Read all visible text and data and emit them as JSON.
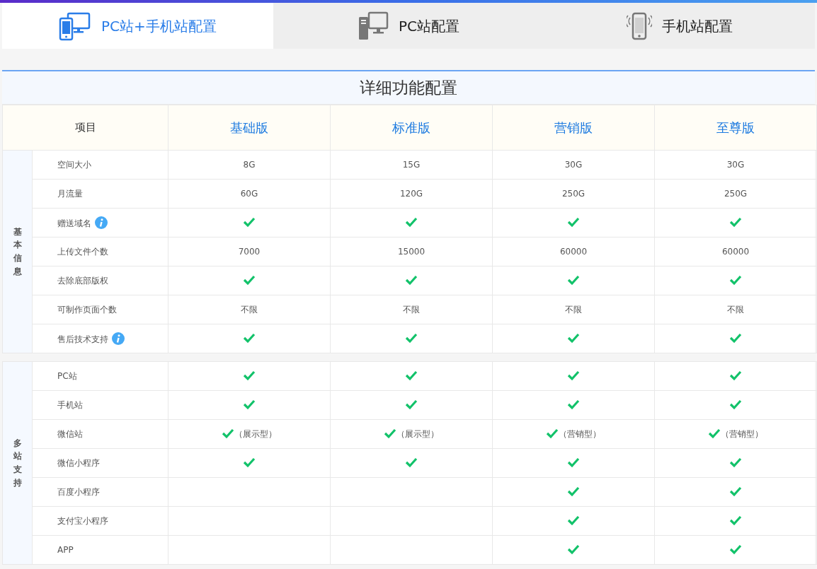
{
  "tabs": [
    {
      "label": "PC站+手机站配置",
      "kind": "combo",
      "selected": true
    },
    {
      "label": "PC站配置",
      "kind": "pc",
      "selected": false
    },
    {
      "label": "手机站配置",
      "kind": "mobile",
      "selected": false
    }
  ],
  "title": "详细功能配置",
  "header": {
    "item_label": "项目",
    "plans": [
      "基础版",
      "标准版",
      "营销版",
      "至尊版"
    ]
  },
  "sections": [
    {
      "label": "基本信息",
      "rows": [
        {
          "name": "空间大小",
          "info": false,
          "cells": [
            {
              "kind": "text",
              "text": "8G"
            },
            {
              "kind": "text",
              "text": "15G"
            },
            {
              "kind": "text",
              "text": "30G"
            },
            {
              "kind": "text",
              "text": "30G"
            }
          ]
        },
        {
          "name": "月流量",
          "info": false,
          "cells": [
            {
              "kind": "text",
              "text": "60G"
            },
            {
              "kind": "text",
              "text": "120G"
            },
            {
              "kind": "text",
              "text": "250G"
            },
            {
              "kind": "text",
              "text": "250G"
            }
          ]
        },
        {
          "name": "赠送域名",
          "info": true,
          "cells": [
            {
              "kind": "check"
            },
            {
              "kind": "check"
            },
            {
              "kind": "check"
            },
            {
              "kind": "check"
            }
          ]
        },
        {
          "name": "上传文件个数",
          "info": false,
          "cells": [
            {
              "kind": "text",
              "text": "7000"
            },
            {
              "kind": "text",
              "text": "15000"
            },
            {
              "kind": "text",
              "text": "60000"
            },
            {
              "kind": "text",
              "text": "60000"
            }
          ]
        },
        {
          "name": "去除底部版权",
          "info": false,
          "cells": [
            {
              "kind": "check"
            },
            {
              "kind": "check"
            },
            {
              "kind": "check"
            },
            {
              "kind": "check"
            }
          ]
        },
        {
          "name": "可制作页面个数",
          "info": false,
          "cells": [
            {
              "kind": "text",
              "text": "不限"
            },
            {
              "kind": "text",
              "text": "不限"
            },
            {
              "kind": "text",
              "text": "不限"
            },
            {
              "kind": "text",
              "text": "不限"
            }
          ]
        },
        {
          "name": "售后技术支持",
          "info": true,
          "cells": [
            {
              "kind": "check"
            },
            {
              "kind": "check"
            },
            {
              "kind": "check"
            },
            {
              "kind": "check"
            }
          ]
        }
      ]
    },
    {
      "label": "多站支持",
      "rows": [
        {
          "name": "PC站",
          "info": false,
          "cells": [
            {
              "kind": "check"
            },
            {
              "kind": "check"
            },
            {
              "kind": "check"
            },
            {
              "kind": "check"
            }
          ]
        },
        {
          "name": "手机站",
          "info": false,
          "cells": [
            {
              "kind": "check"
            },
            {
              "kind": "check"
            },
            {
              "kind": "check"
            },
            {
              "kind": "check"
            }
          ]
        },
        {
          "name": "微信站",
          "info": false,
          "cells": [
            {
              "kind": "check",
              "note": "（展示型）"
            },
            {
              "kind": "check",
              "note": "（展示型）"
            },
            {
              "kind": "check",
              "note": "（营销型）"
            },
            {
              "kind": "check",
              "note": "（营销型）"
            }
          ]
        },
        {
          "name": "微信小程序",
          "info": false,
          "cells": [
            {
              "kind": "check"
            },
            {
              "kind": "check"
            },
            {
              "kind": "check"
            },
            {
              "kind": "check"
            }
          ]
        },
        {
          "name": "百度小程序",
          "info": false,
          "cells": [
            {
              "kind": "none"
            },
            {
              "kind": "none"
            },
            {
              "kind": "check"
            },
            {
              "kind": "check"
            }
          ]
        },
        {
          "name": "支付宝小程序",
          "info": false,
          "cells": [
            {
              "kind": "none"
            },
            {
              "kind": "none"
            },
            {
              "kind": "check"
            },
            {
              "kind": "check"
            }
          ]
        },
        {
          "name": "APP",
          "info": false,
          "cells": [
            {
              "kind": "none"
            },
            {
              "kind": "none"
            },
            {
              "kind": "check"
            },
            {
              "kind": "check"
            }
          ]
        }
      ]
    }
  ]
}
